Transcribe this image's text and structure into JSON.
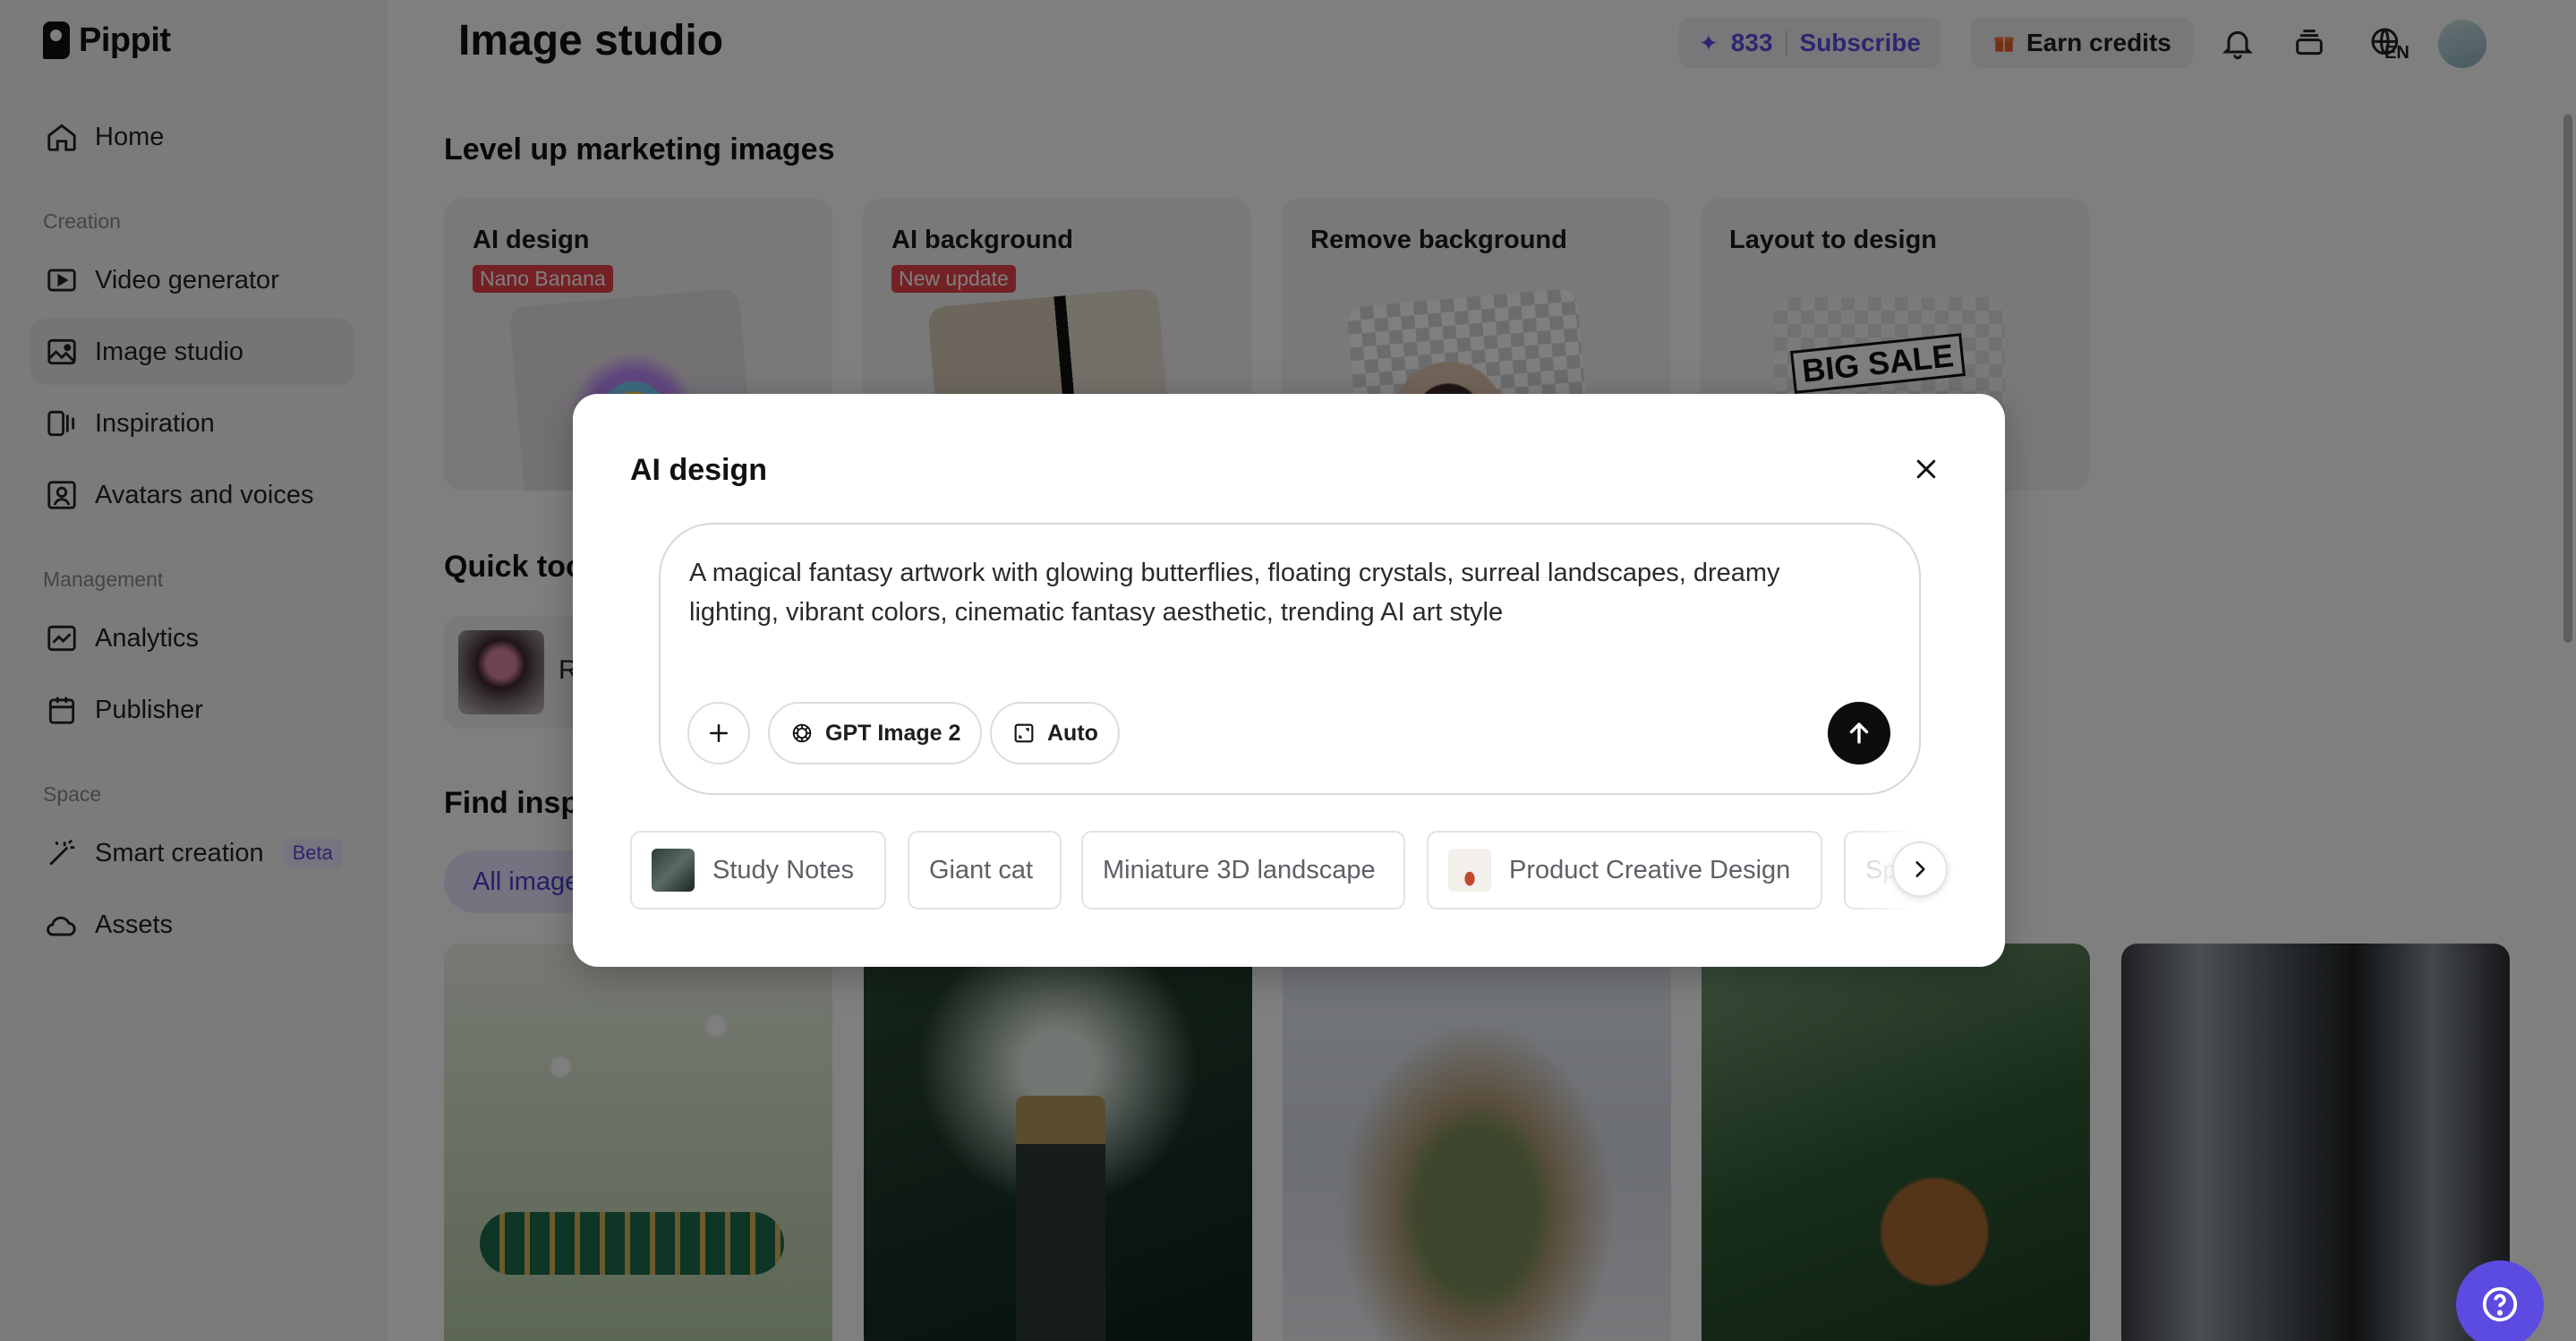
{
  "app": {
    "name": "Pippit"
  },
  "sidebar": {
    "home": "Home",
    "creation_label": "Creation",
    "video_generator": "Video generator",
    "image_studio": "Image studio",
    "inspiration": "Inspiration",
    "avatars_voices": "Avatars and voices",
    "management_label": "Management",
    "analytics": "Analytics",
    "publisher": "Publisher",
    "space_label": "Space",
    "smart_creation": "Smart creation",
    "smart_creation_badge": "Beta",
    "assets": "Assets"
  },
  "header": {
    "title": "Image studio",
    "credits": "833",
    "subscribe": "Subscribe",
    "earn_credits": "Earn credits",
    "language": "EN"
  },
  "main": {
    "section1": "Level up marketing images",
    "cards": [
      {
        "title": "AI design",
        "tag": "Nano Banana"
      },
      {
        "title": "AI background",
        "tag": "New update"
      },
      {
        "title": "Remove background",
        "tag": ""
      },
      {
        "title": "Layout to design",
        "tag": "",
        "thumb_text": "BIG SALE"
      }
    ],
    "section2": "Quick tools",
    "quick_tool_label": "R",
    "section3": "Find inspiration",
    "filter_all": "All images"
  },
  "modal": {
    "title": "AI design",
    "prompt": "A magical fantasy artwork with glowing butterflies, floating crystals, surreal landscapes, dreamy lighting, vibrant colors, cinematic fantasy aesthetic, trending AI art style",
    "model": "GPT Image 2",
    "ratio": "Auto",
    "suggestions": [
      "Study Notes",
      "Giant cat",
      "Miniature 3D landscape",
      "Product Creative Design",
      "Sp"
    ]
  },
  "colors": {
    "accent": "#5b4be0",
    "tag_red": "#e8424a",
    "overlay": "rgba(0,0,0,0.5)"
  }
}
